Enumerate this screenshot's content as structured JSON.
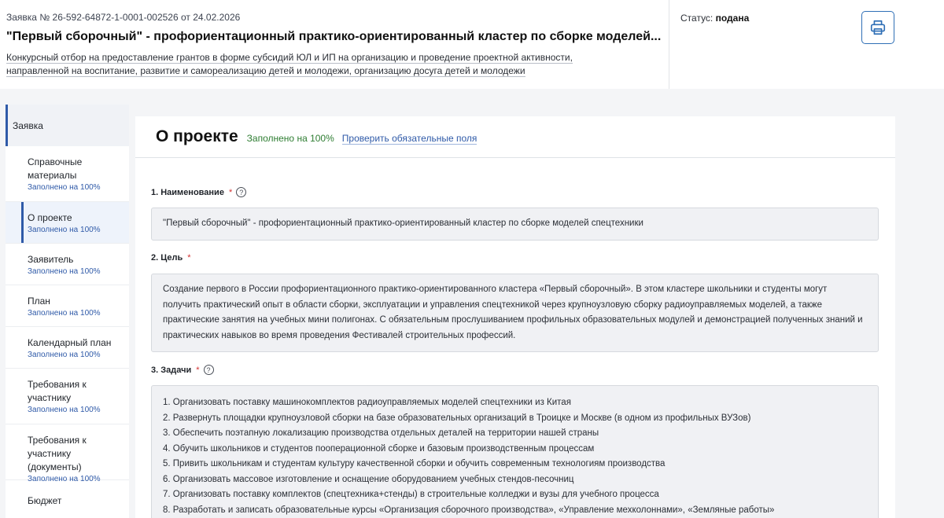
{
  "header": {
    "app_number": "Заявка № 26-592-64872-1-0001-002526 от 24.02.2026",
    "title": "\"Первый сборочный\" - профориентационный практико-ориентированный кластер по сборке моделей...",
    "contest": "Конкурсный отбор на предоставление грантов в форме субсидий ЮЛ и ИП на организацию и проведение проектной активности, направленной на воспитание, развитие и самореализацию детей и молодежи, организацию досуга детей и молодежи",
    "status_label": "Статус:",
    "status_value": "подана",
    "print_icon": "printer-icon"
  },
  "sidebar": {
    "header": "Заявка",
    "items": [
      {
        "label": "Справочные материалы",
        "pct": "Заполнено на 100%"
      },
      {
        "label": "О проекте",
        "pct": "Заполнено на 100%"
      },
      {
        "label": "Заявитель",
        "pct": "Заполнено на 100%"
      },
      {
        "label": "План",
        "pct": "Заполнено на 100%"
      },
      {
        "label": "Календарный план",
        "pct": "Заполнено на 100%"
      },
      {
        "label": "Требования к участнику",
        "pct": "Заполнено на 100%"
      },
      {
        "label": "Требования к участнику (документы)",
        "pct": "Заполнено на 100%"
      },
      {
        "label": "Бюджет",
        "pct": ""
      }
    ]
  },
  "main": {
    "title": "О проекте",
    "fill_pct": "Заполнено на 100%",
    "check_link": "Проверить обязательные поля",
    "fields": {
      "name": {
        "label": "1. Наименование",
        "required": "*",
        "value": "\"Первый сборочный\" - профориентационный практико-ориентированный кластер по сборке моделей спецтехники"
      },
      "goal": {
        "label": "2. Цель",
        "required": "*",
        "value": "Создание первого в России профориентационного практико-ориентированного кластера «Первый сборочный». В этом кластере школьники и студенты могут получить практический опыт в области сборки, эксплуатации и управления спецтехникой через крупноузловую сборку радиоуправляемых моделей, а также практические занятия на учебных мини полигонах. С обязательным прослушиванием профильных образовательных модулей и демонстрацией полученных знаний и практических навыков во время проведения Фестивалей строительных профессий."
      },
      "tasks": {
        "label": "3. Задачи",
        "required": "*",
        "items": [
          "1. Организовать поставку машинокомплектов радиоуправляемых моделей спецтехники из Китая",
          "2. Развернуть площадки крупноузловой сборки на базе образовательных организаций в Троицке и Москве (в одном из профильных ВУЗов)",
          "3. Обеспечить поэтапную локализацию производства отдельных деталей на территории нашей страны",
          "4. Обучить школьников и студентов пооперационной сборке и базовым производственным процессам",
          "5. Привить школьникам и студентам культуру качественной сборки и обучить современным технологиям производства",
          "6. Организовать массовое изготовление и оснащение оборудованием учебных стендов-песочниц",
          "7. Организовать поставку комплектов (спецтехника+стенды) в строительные колледжи и вузы для учебного процесса",
          "8. Разработать и записать образовательные курсы «Организация сборочного производства», «Управление мехколоннами», «Земляные работы»"
        ]
      }
    }
  }
}
